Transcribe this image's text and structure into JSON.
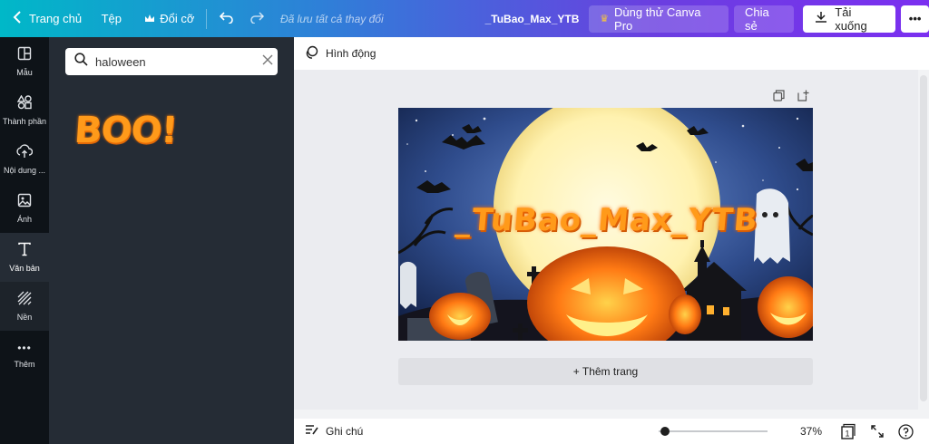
{
  "topbar": {
    "home_label": "Trang chủ",
    "file_label": "Tệp",
    "resize_label": "Đổi cỡ",
    "saved_status": "Đã lưu tất cả thay đổi",
    "design_title": "_TuBao_Max_YTB",
    "try_pro_label": "Dùng thử Canva Pro",
    "share_label": "Chia sẻ",
    "download_label": "Tải xuống"
  },
  "rail": {
    "items": [
      {
        "label": "Mẫu",
        "icon": "layout-icon"
      },
      {
        "label": "Thành phần",
        "icon": "shapes-icon"
      },
      {
        "label": "Nội dung ...",
        "icon": "upload-icon"
      },
      {
        "label": "Ảnh",
        "icon": "image-icon"
      },
      {
        "label": "Văn bản",
        "icon": "text-icon"
      },
      {
        "label": "Nền",
        "icon": "background-icon"
      },
      {
        "label": "Thêm",
        "icon": "more-icon"
      }
    ]
  },
  "panel": {
    "search_value": "haloween",
    "result_text": "BOO!"
  },
  "subbar": {
    "animate_label": "Hình động"
  },
  "design": {
    "headline": "_TuBao_Max_YTB",
    "colors": {
      "headline": "#ff9a1a",
      "sky": "#2f4c8c",
      "moon": "#fff6c8"
    }
  },
  "canvas": {
    "add_page_label": "+ Thêm trang"
  },
  "footer": {
    "notes_label": "Ghi chú",
    "zoom": "37%",
    "zoom_fraction": 0.37,
    "page_count": "1"
  },
  "colors": {
    "topbar_start": "#00b8c8",
    "topbar_end": "#7b2ff0",
    "rail_bg": "#0e1318",
    "panel_bg": "#252c35"
  }
}
